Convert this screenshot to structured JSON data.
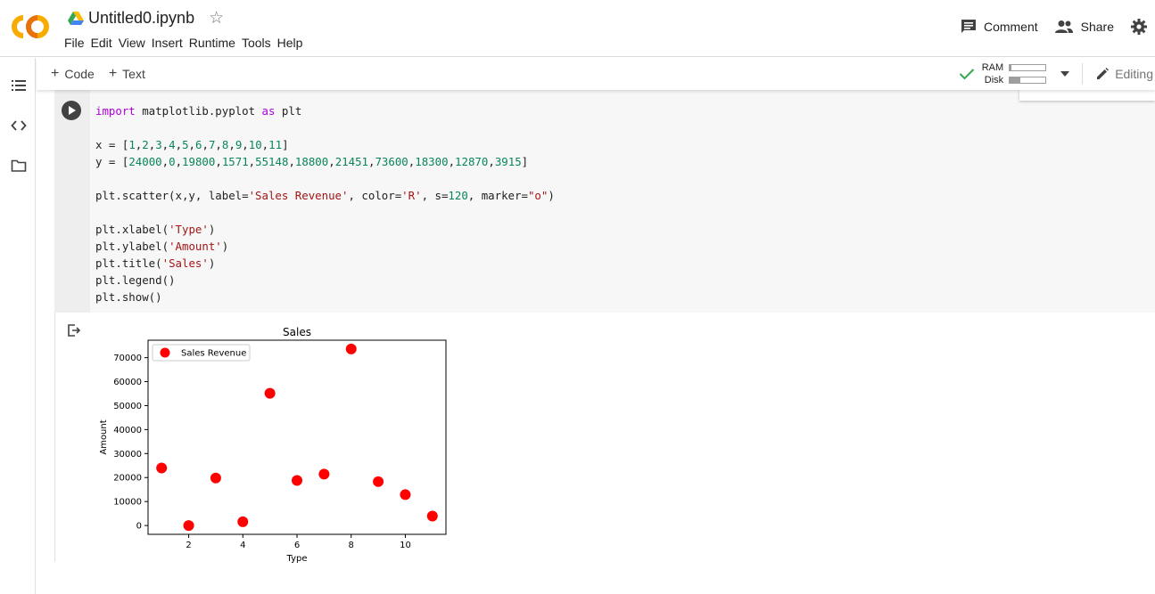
{
  "header": {
    "notebook_title": "Untitled0.ipynb",
    "menu": [
      "File",
      "Edit",
      "View",
      "Insert",
      "Runtime",
      "Tools",
      "Help"
    ],
    "comment_label": "Comment",
    "share_label": "Share"
  },
  "toolbar": {
    "code_label": "Code",
    "text_label": "Text",
    "ram_label": "RAM",
    "disk_label": "Disk",
    "ram_usage": 0.05,
    "disk_usage": 0.3,
    "editing_label": "Editing"
  },
  "cell": {
    "code_lines": [
      "import matplotlib.pyplot as plt",
      "",
      "x = [1,2,3,4,5,6,7,8,9,10,11]",
      "y = [24000,0,19800,1571,55148,18800,21451,73600,18300,12870,3915]",
      "",
      "plt.scatter(x,y, label='Sales Revenue', color='R', s=120, marker=\"o\")",
      "",
      "plt.xlabel('Type')",
      "plt.ylabel('Amount')",
      "plt.title('Sales')",
      "plt.legend()",
      "plt.show()"
    ]
  },
  "colors": {
    "marker": "#ff0000",
    "logo_orange": "#f9ab00",
    "logo_yellow": "#e8710a"
  },
  "chart_data": {
    "type": "scatter",
    "title": "Sales",
    "xlabel": "Type",
    "ylabel": "Amount",
    "x": [
      1,
      2,
      3,
      4,
      5,
      6,
      7,
      8,
      9,
      10,
      11
    ],
    "y": [
      24000,
      0,
      19800,
      1571,
      55148,
      18800,
      21451,
      73600,
      18300,
      12870,
      3915
    ],
    "series": [
      {
        "name": "Sales Revenue",
        "color": "#ff0000"
      }
    ],
    "xticks": [
      2,
      4,
      6,
      8,
      10
    ],
    "yticks": [
      0,
      10000,
      20000,
      30000,
      40000,
      50000,
      60000,
      70000
    ],
    "xlim": [
      0.5,
      11.5
    ],
    "ylim": [
      -3680,
      77280
    ],
    "legend": "upper-left",
    "grid": false
  }
}
